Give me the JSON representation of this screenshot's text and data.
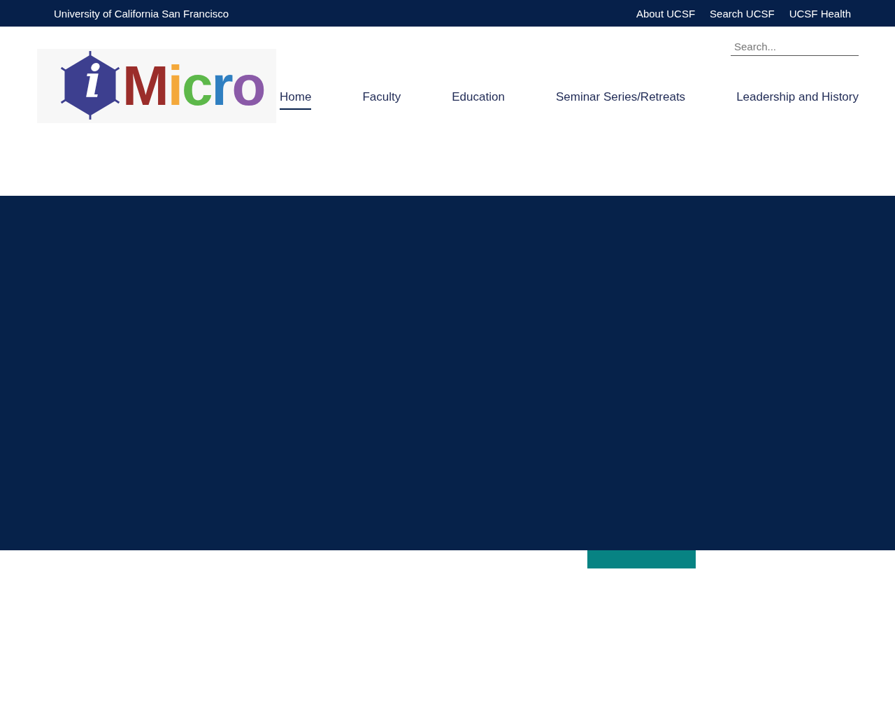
{
  "top_bar": {
    "title": "University of California San Francisco",
    "links": [
      "About UCSF",
      "Search UCSF",
      "UCSF Health"
    ]
  },
  "search": {
    "placeholder": "Search..."
  },
  "logo": {
    "letters": [
      {
        "char": "i",
        "color": "#ffffff"
      },
      {
        "char": "M",
        "color": "#9b2d2a"
      },
      {
        "char": "i",
        "color": "#f4a83a"
      },
      {
        "char": "c",
        "color": "#5db84a"
      },
      {
        "char": "r",
        "color": "#2f7fc1"
      },
      {
        "char": "o",
        "color": "#8a5aa8"
      }
    ]
  },
  "nav": [
    {
      "label": "Home",
      "selected": true
    },
    {
      "label": "Faculty",
      "selected": false
    },
    {
      "label": "Education",
      "selected": false
    },
    {
      "label": "Seminar Series/Retreats",
      "selected": false
    },
    {
      "label": "Leadership and History",
      "selected": false
    }
  ]
}
